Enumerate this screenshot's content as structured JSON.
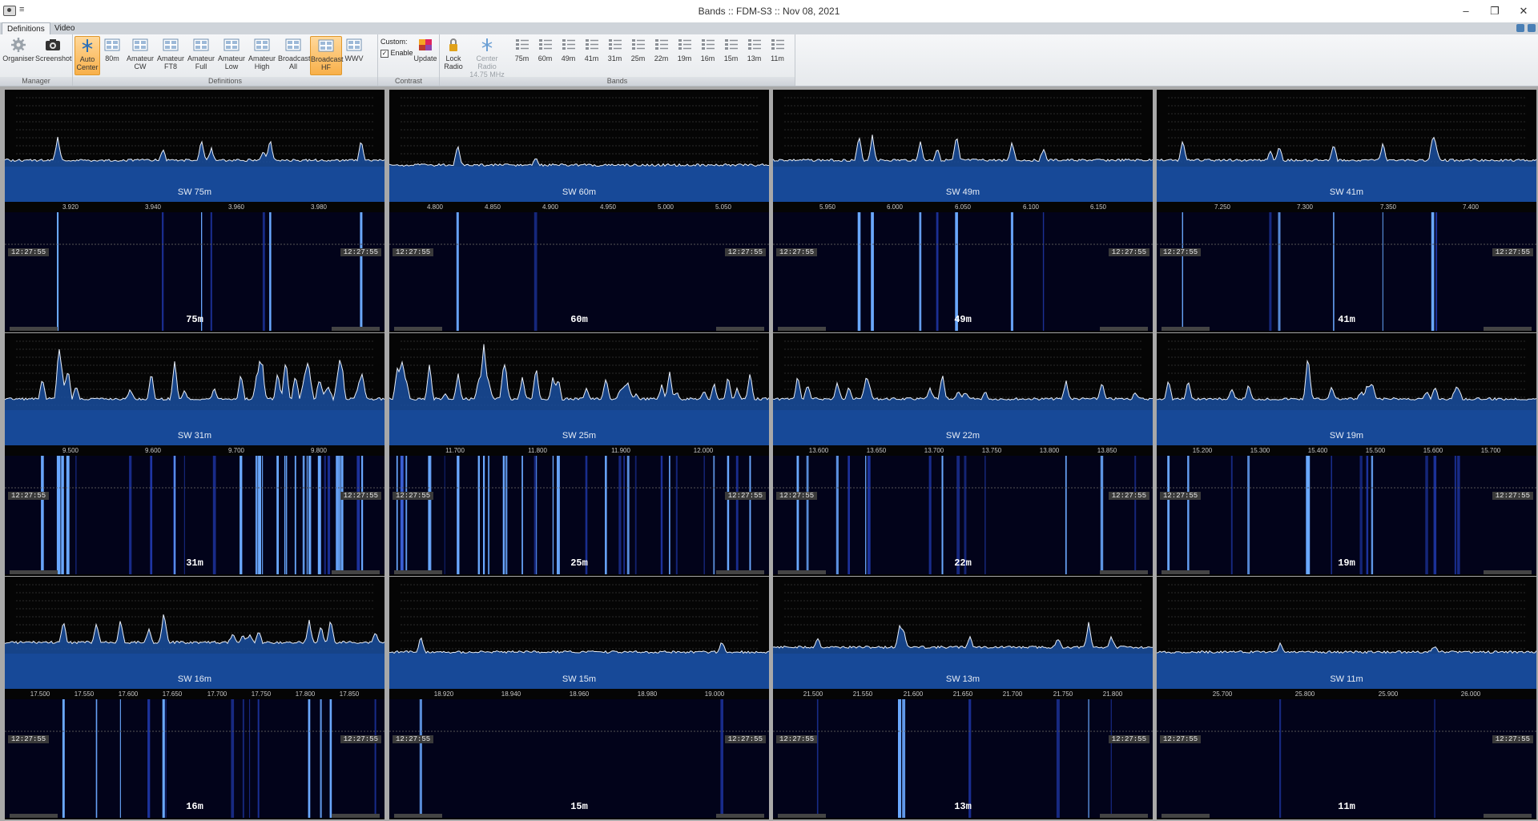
{
  "window": {
    "title": "Bands :: FDM-S3 :: Nov 08, 2021",
    "pin_glyph": "≡",
    "buttons": {
      "minimize": "–",
      "restore": "❐",
      "close": "✕"
    }
  },
  "tabs": [
    "Definitions",
    "Video"
  ],
  "ribbon": {
    "manager": {
      "label": "Manager",
      "buttons": [
        {
          "label": "Organiser",
          "icon": "gear-icon"
        },
        {
          "label": "Screenshot",
          "icon": "camera-icon"
        }
      ]
    },
    "definitions": {
      "label": "Definitions",
      "buttons": [
        {
          "line1": "Auto",
          "line2": "Center",
          "active": true
        },
        {
          "line1": "80m",
          "line2": ""
        },
        {
          "line1": "Amateur",
          "line2": "CW"
        },
        {
          "line1": "Amateur",
          "line2": "FT8"
        },
        {
          "line1": "Amateur",
          "line2": "Full"
        },
        {
          "line1": "Amateur",
          "line2": "Low"
        },
        {
          "line1": "Amateur",
          "line2": "High"
        },
        {
          "line1": "Broadcast",
          "line2": "All"
        },
        {
          "line1": "Broadcast",
          "line2": "HF",
          "active": true
        },
        {
          "line1": "WWV",
          "line2": ""
        }
      ]
    },
    "contrast": {
      "label": "Contrast",
      "custom_label": "Custom:",
      "enable_label": "Enable",
      "enable_checked": true,
      "update_label": "Update"
    },
    "bands": {
      "label": "Bands",
      "lock": {
        "line1": "Lock",
        "line2": "Radio"
      },
      "center": {
        "line1": "Center Radio",
        "line2": "14.75 MHz"
      },
      "buttons": [
        "75m",
        "60m",
        "49m",
        "41m",
        "31m",
        "25m",
        "22m",
        "19m",
        "16m",
        "15m",
        "13m",
        "11m"
      ]
    }
  },
  "timestamp": "12:27:55",
  "panels": [
    {
      "title": "SW 75m",
      "label": "75m",
      "ticks": [
        "3.920",
        "3.940",
        "3.960",
        "3.980"
      ],
      "seed": 1,
      "level": "low"
    },
    {
      "title": "SW 60m",
      "label": "60m",
      "ticks": [
        "4.800",
        "4.850",
        "4.900",
        "4.950",
        "5.000",
        "5.050"
      ],
      "seed": 2,
      "level": "flat"
    },
    {
      "title": "SW 49m",
      "label": "49m",
      "ticks": [
        "5.950",
        "6.000",
        "6.050",
        "6.100",
        "6.150"
      ],
      "seed": 3,
      "level": "low"
    },
    {
      "title": "SW 41m",
      "label": "41m",
      "ticks": [
        "7.250",
        "7.300",
        "7.350",
        "7.400"
      ],
      "seed": 4,
      "level": "low"
    },
    {
      "title": "SW 31m",
      "label": "31m",
      "ticks": [
        "9.500",
        "9.600",
        "9.700",
        "9.800"
      ],
      "seed": 5,
      "level": "busy"
    },
    {
      "title": "SW 25m",
      "label": "25m",
      "ticks": [
        "11.700",
        "11.800",
        "11.900",
        "12.000"
      ],
      "seed": 6,
      "level": "busy"
    },
    {
      "title": "SW 22m",
      "label": "22m",
      "ticks": [
        "13.600",
        "13.650",
        "13.700",
        "13.750",
        "13.800",
        "13.850"
      ],
      "seed": 7,
      "level": "mid"
    },
    {
      "title": "SW 19m",
      "label": "19m",
      "ticks": [
        "15.200",
        "15.300",
        "15.400",
        "15.500",
        "15.600",
        "15.700"
      ],
      "seed": 8,
      "level": "mid"
    },
    {
      "title": "SW 16m",
      "label": "16m",
      "ticks": [
        "17.500",
        "17.550",
        "17.600",
        "17.650",
        "17.700",
        "17.750",
        "17.800",
        "17.850"
      ],
      "seed": 9,
      "level": "mid"
    },
    {
      "title": "SW 15m",
      "label": "15m",
      "ticks": [
        "18.920",
        "18.940",
        "18.960",
        "18.980",
        "19.000"
      ],
      "seed": 10,
      "level": "flat"
    },
    {
      "title": "SW 13m",
      "label": "13m",
      "ticks": [
        "21.500",
        "21.550",
        "21.600",
        "21.650",
        "21.700",
        "21.750",
        "21.800"
      ],
      "seed": 11,
      "level": "low"
    },
    {
      "title": "SW 11m",
      "label": "11m",
      "ticks": [
        "25.700",
        "25.800",
        "25.900",
        "26.000"
      ],
      "seed": 12,
      "level": "flat"
    }
  ],
  "colors": {
    "spectrum_fill": "#1a4fa0",
    "trace": "#e8eef8",
    "waterfall": "#02031a",
    "accent": "#f8b04a"
  }
}
